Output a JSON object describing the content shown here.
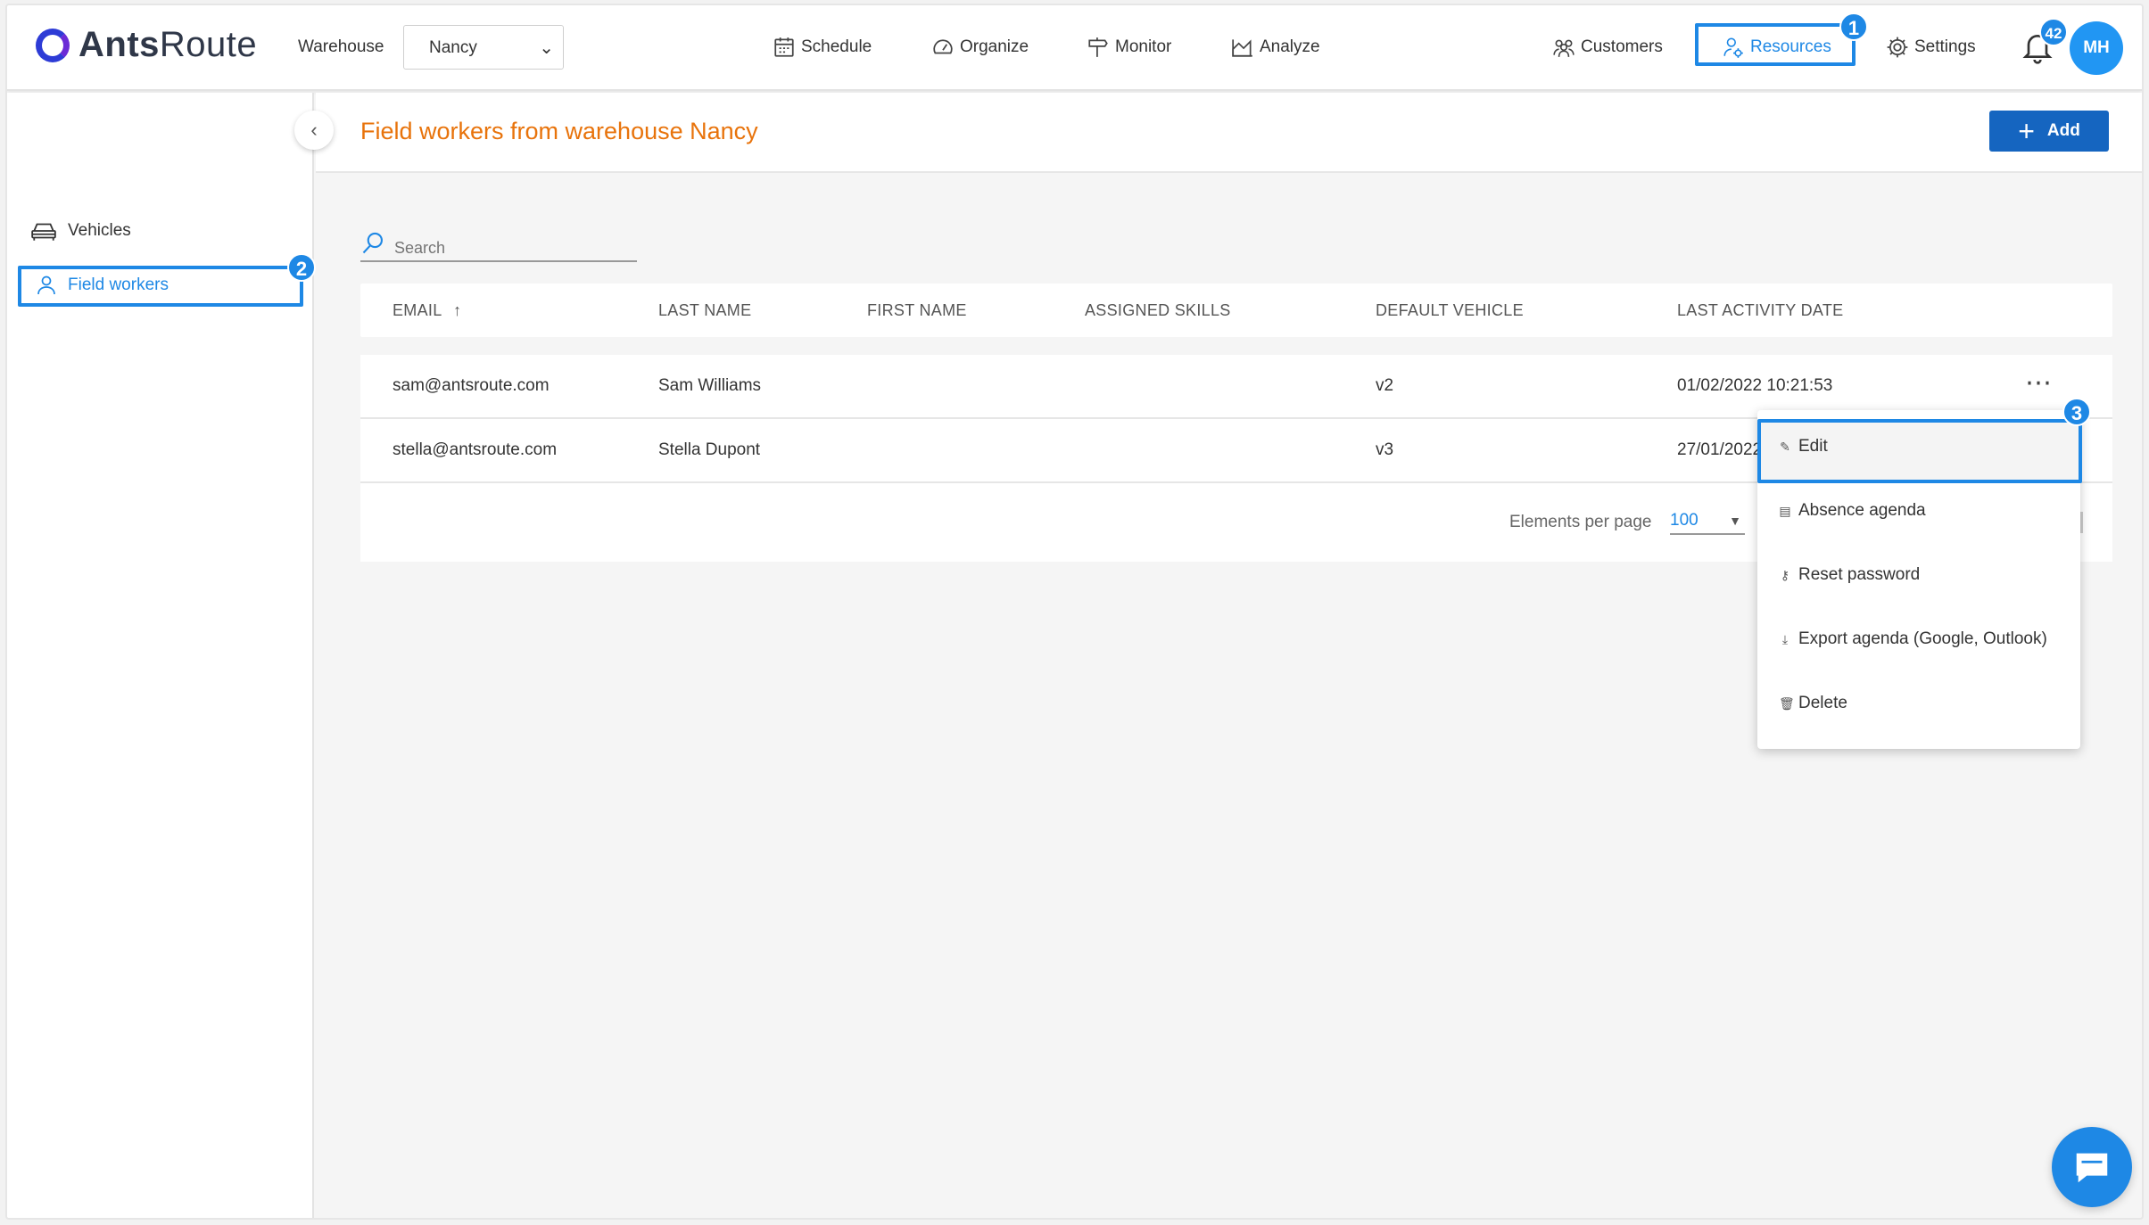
{
  "app": {
    "brand_bold": "Ants",
    "brand_light": "Route"
  },
  "header": {
    "warehouse_label": "Warehouse",
    "warehouse_value": "Nancy",
    "nav": {
      "schedule": "Schedule",
      "organize": "Organize",
      "monitor": "Monitor",
      "analyze": "Analyze"
    },
    "right_nav": {
      "customers": "Customers",
      "resources": "Resources",
      "settings": "Settings"
    },
    "notifications_count": "42",
    "avatar_initials": "MH"
  },
  "steps": {
    "one": "1",
    "two": "2",
    "three": "3"
  },
  "sidebar": {
    "vehicles": "Vehicles",
    "field_workers": "Field workers"
  },
  "main": {
    "title": "Field workers from warehouse Nancy",
    "add_label": "Add",
    "search_placeholder": "Search",
    "columns": {
      "email": "EMAIL",
      "sort_icon": "↑",
      "last_name": "LAST NAME",
      "first_name": "FIRST NAME",
      "skills": "ASSIGNED SKILLS",
      "vehicle": "DEFAULT VEHICLE",
      "last_activity": "LAST ACTIVITY DATE"
    },
    "rows": [
      {
        "email": "sam@antsroute.com",
        "last_name": "Sam Williams",
        "first_name": "",
        "skills": "",
        "vehicle": "v2",
        "last_activity": "01/02/2022 10:21:53"
      },
      {
        "email": "stella@antsroute.com",
        "last_name": "Stella Dupont",
        "first_name": "",
        "skills": "",
        "vehicle": "v3",
        "last_activity": "27/01/2022"
      }
    ],
    "per_page_label": "Elements per page",
    "per_page_value": "100"
  },
  "menu": {
    "edit": "Edit",
    "absence": "Absence agenda",
    "reset": "Reset password",
    "export": "Export agenda (Google, Outlook)",
    "delete": "Delete"
  },
  "colors": {
    "accent": "#1e88e5",
    "title": "#e8730b",
    "add_button": "#1565c0"
  }
}
